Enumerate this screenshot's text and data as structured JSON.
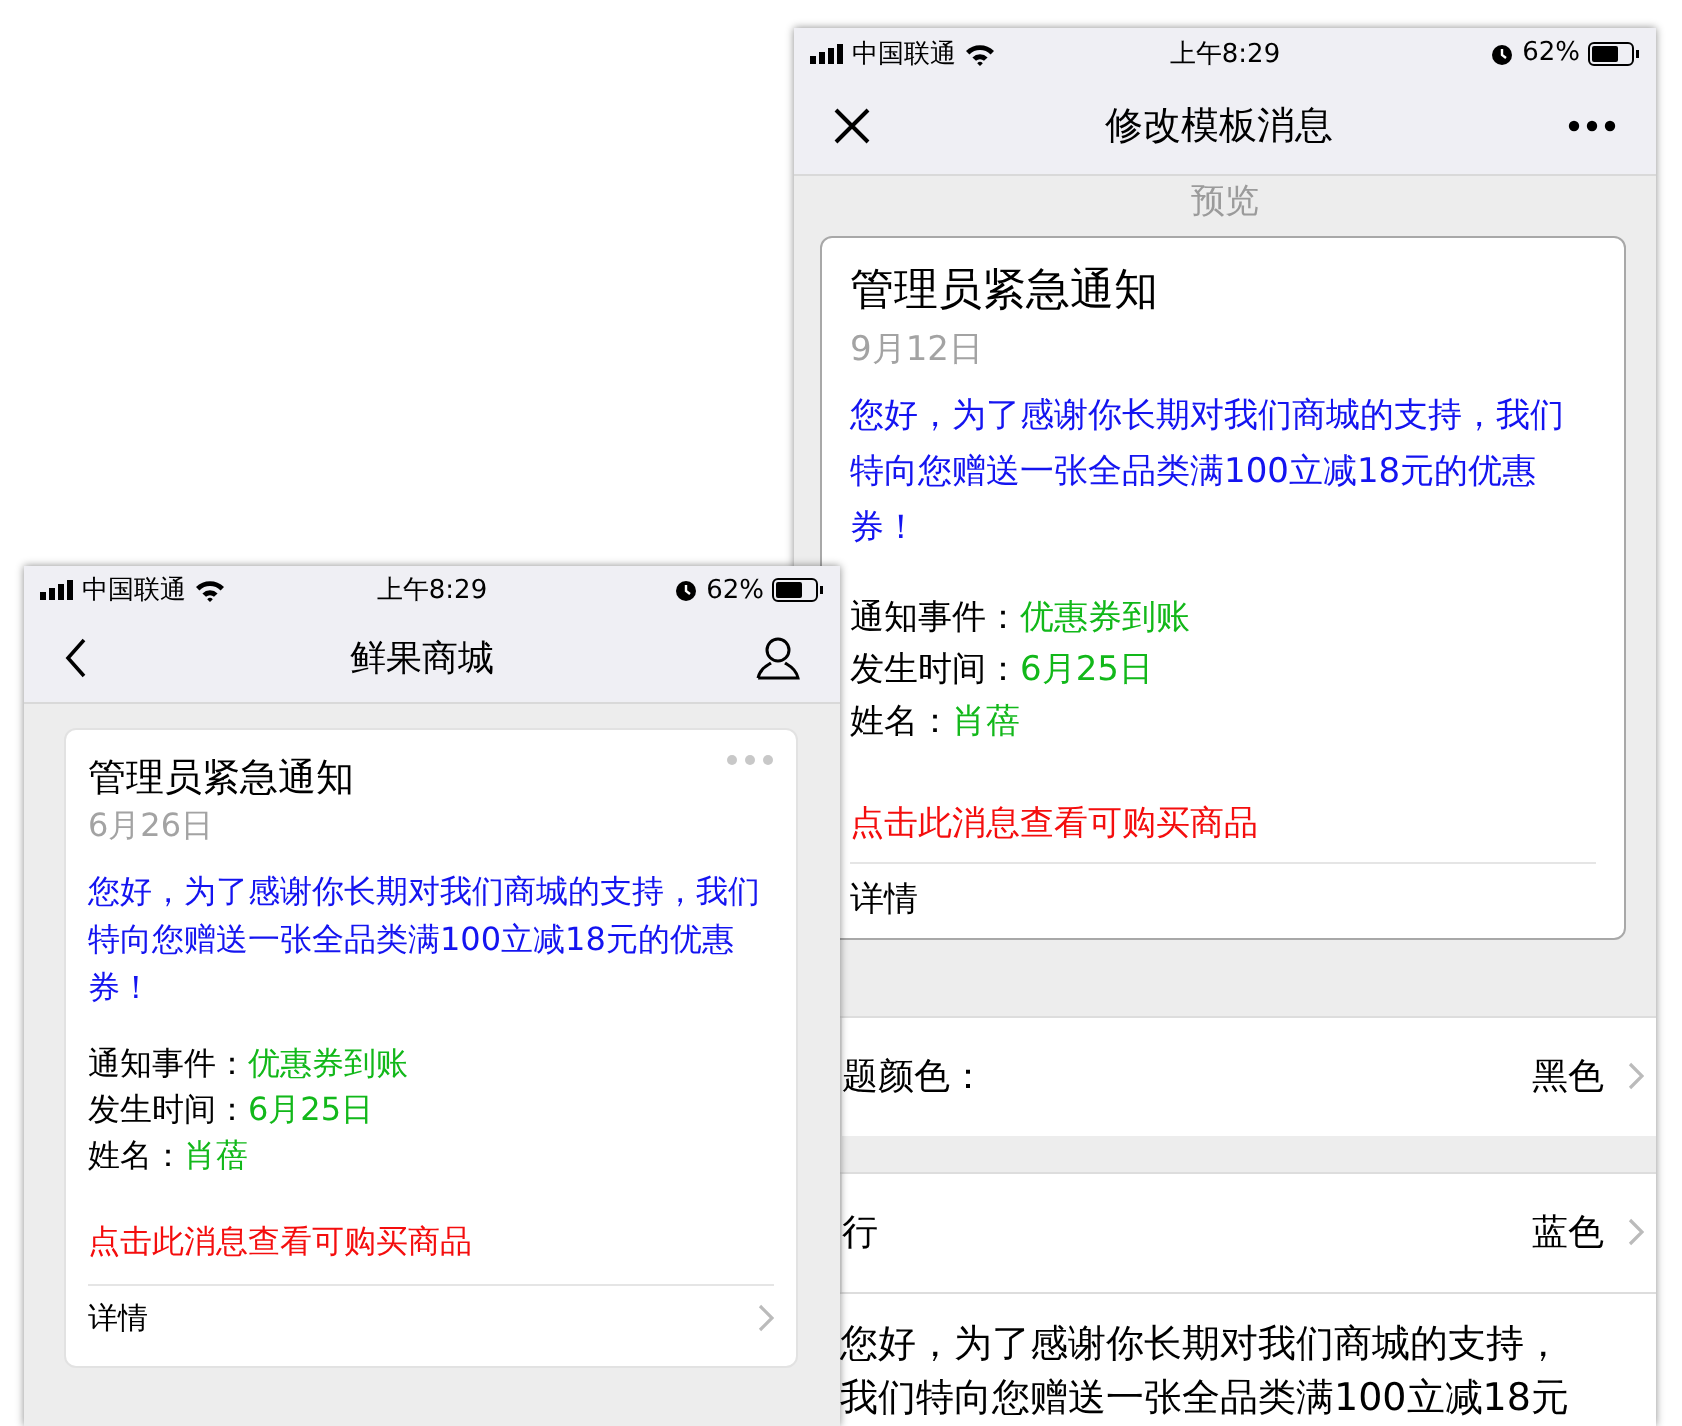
{
  "phones": [
    {
      "kind": "editor",
      "status": {
        "carrier": "中国联通",
        "time": "上午8:29",
        "battery": "62%"
      },
      "nav": {
        "title": "修改模板消息"
      },
      "section_label": "预览",
      "card": {
        "title": "管理员紧急通知",
        "date": "9月12日",
        "body": "您好，为了感谢你长期对我们商城的支持，我们特向您赠送一张全品类满100立减18元的优惠券！",
        "fields": [
          {
            "label": "通知事件：",
            "value": "优惠券到账"
          },
          {
            "label": "发生时间：",
            "value": "6月25日"
          },
          {
            "label": "姓名：",
            "value": "肖蓓"
          }
        ],
        "link": "点击此消息查看可购买商品",
        "detail": "详情"
      },
      "settings": [
        {
          "label": "题颜色：",
          "value": "黑色"
        },
        {
          "label": "行",
          "value": "蓝色"
        }
      ],
      "preview_lines": [
        "您好，为了感谢你长期对我们商城的支持，",
        "我们特向您赠送一张全品类满100立减18元"
      ]
    },
    {
      "kind": "chat",
      "status": {
        "carrier": "中国联通",
        "time": "上午8:29",
        "battery": "62%"
      },
      "nav": {
        "title": "鲜果商城"
      },
      "card": {
        "title": "管理员紧急通知",
        "date": "6月26日",
        "body": "您好，为了感谢你长期对我们商城的支持，我们特向您赠送一张全品类满100立减18元的优惠券！",
        "fields": [
          {
            "label": "通知事件：",
            "value": "优惠券到账"
          },
          {
            "label": "发生时间：",
            "value": "6月25日"
          },
          {
            "label": "姓名：",
            "value": "肖蓓"
          }
        ],
        "link": "点击此消息查看可购买商品",
        "detail": "详情"
      }
    }
  ]
}
